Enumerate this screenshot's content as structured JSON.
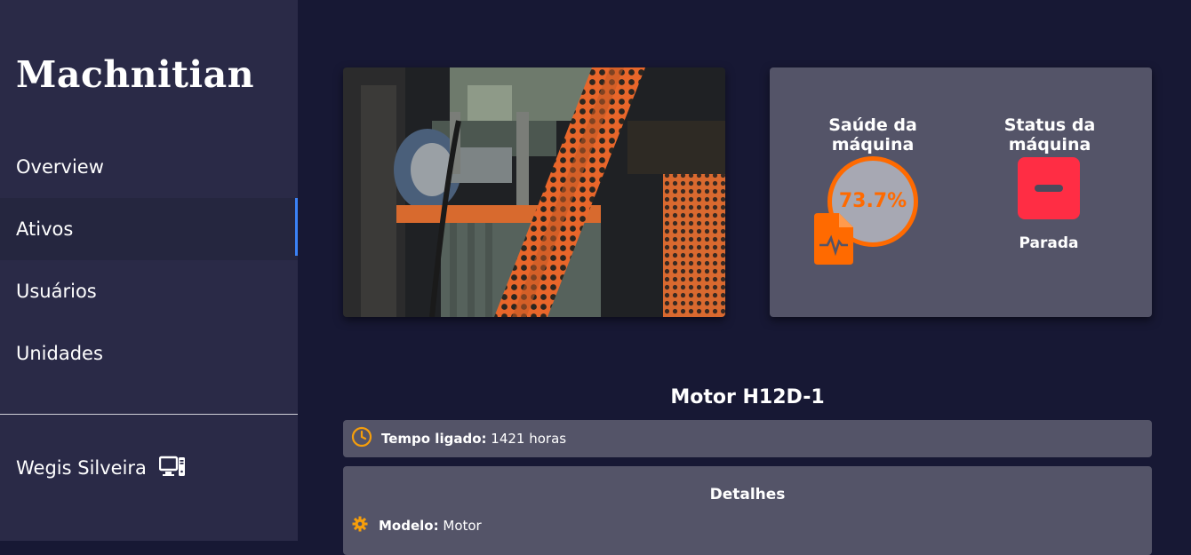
{
  "sidebar": {
    "brand": "Machnitian",
    "items": [
      {
        "label": "Overview"
      },
      {
        "label": "Ativos"
      },
      {
        "label": "Usuários"
      },
      {
        "label": "Unidades"
      }
    ],
    "user": {
      "name": "Wegis Silveira",
      "icon": "computer-icon"
    }
  },
  "status": {
    "health_title": "Saúde da máquina",
    "health_value": "73.7%",
    "machine_title": "Status da máquina",
    "machine_status": "Parada"
  },
  "asset": {
    "name": "Motor H12D-1",
    "uptime_label": "Tempo ligado:",
    "uptime_value": "1421 horas"
  },
  "details": {
    "title": "Detalhes",
    "model_label": "Modelo:",
    "model_value": "Motor"
  },
  "colors": {
    "accent": "#ff6a00",
    "stop": "#ff2d44",
    "active_indicator": "#3b82f6",
    "clock": "#f59e0b"
  }
}
